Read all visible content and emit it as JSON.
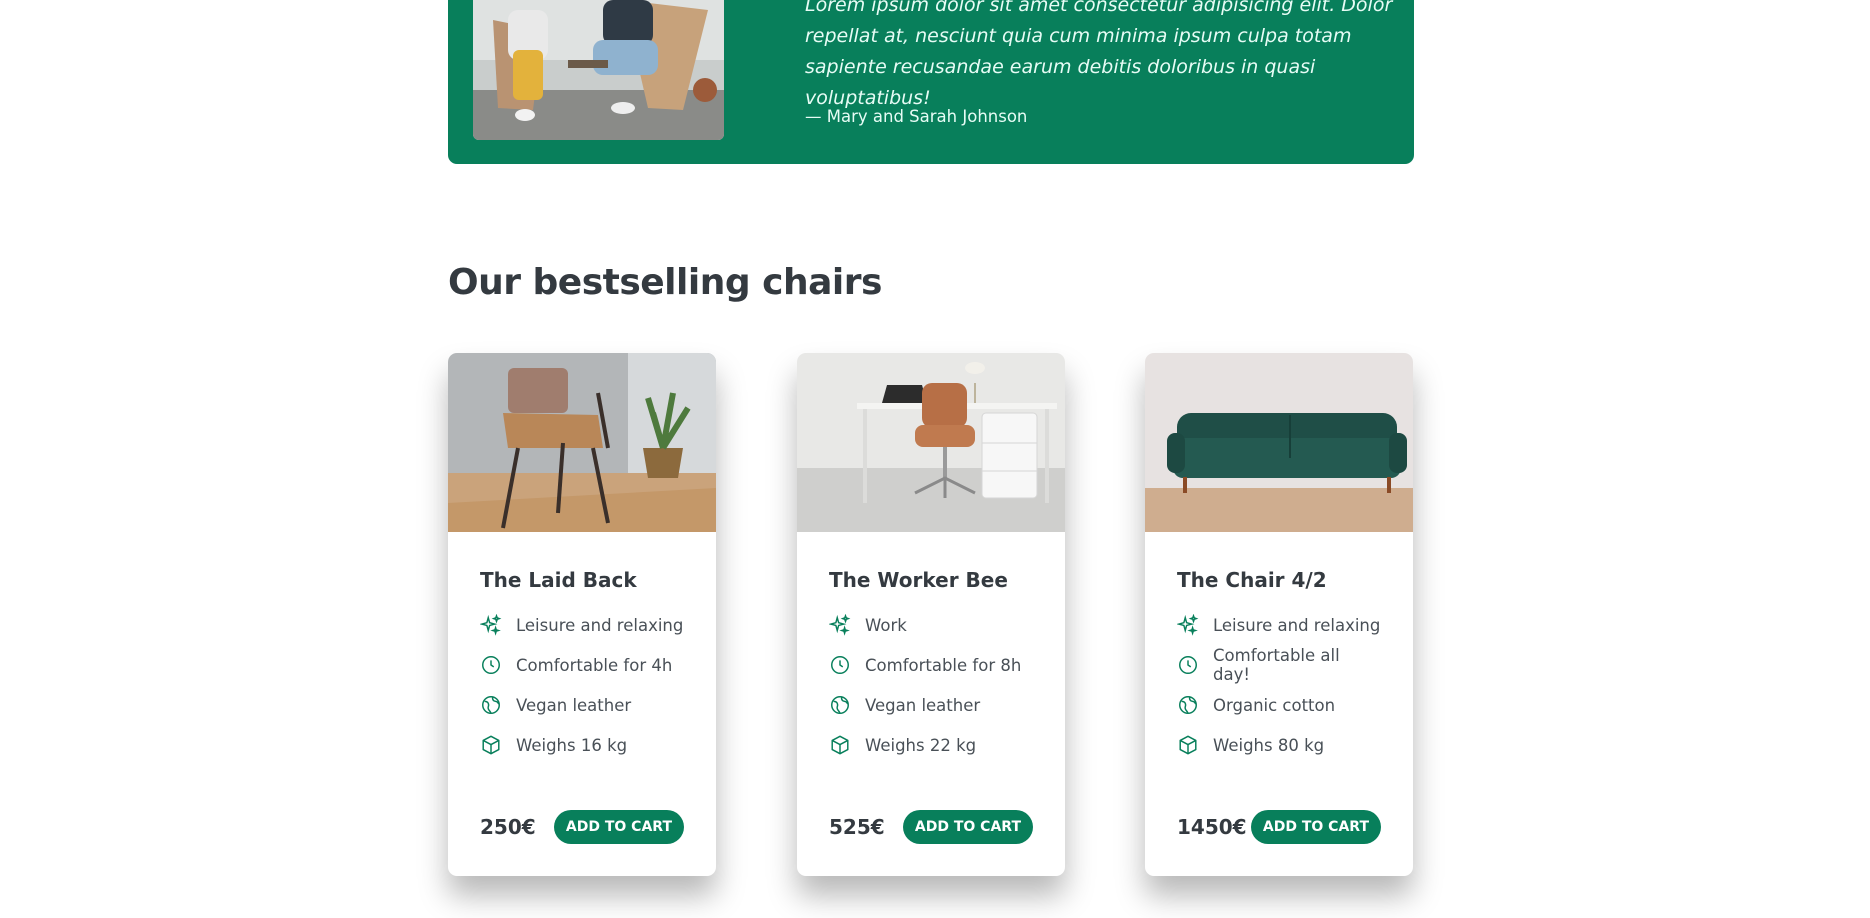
{
  "testimonial": {
    "quote": "Lorem ipsum dolor sit amet consectetur adipisicing elit. Dolor repellat at, nesciunt quia cum minima ipsum culpa totam sapiente recusandae earum debitis doloribus in quasi voluptatibus!",
    "author": "— Mary and Sarah Johnson"
  },
  "section": {
    "heading": "Our bestselling chairs"
  },
  "products": [
    {
      "name": "The Laid Back",
      "attributes": [
        "Leisure and relaxing",
        "Comfortable for 4h",
        "Vegan leather",
        "Weighs 16 kg"
      ],
      "price": "250€",
      "cta": "ADD TO CART"
    },
    {
      "name": "The Worker Bee",
      "attributes": [
        "Work",
        "Comfortable for 8h",
        "Vegan leather",
        "Weighs 22 kg"
      ],
      "price": "525€",
      "cta": "ADD TO CART"
    },
    {
      "name": "The Chair 4/2",
      "attributes": [
        "Leisure and relaxing",
        "Comfortable all day!",
        "Organic cotton",
        "Weighs 80 kg"
      ],
      "price": "1450€",
      "cta": "ADD TO CART"
    }
  ],
  "attribute_icons": [
    "sparkles-icon",
    "clock-icon",
    "globe-icon",
    "cube-icon"
  ],
  "colors": {
    "brand": "#087f5b",
    "text": "#343a40",
    "muted": "#495057"
  }
}
